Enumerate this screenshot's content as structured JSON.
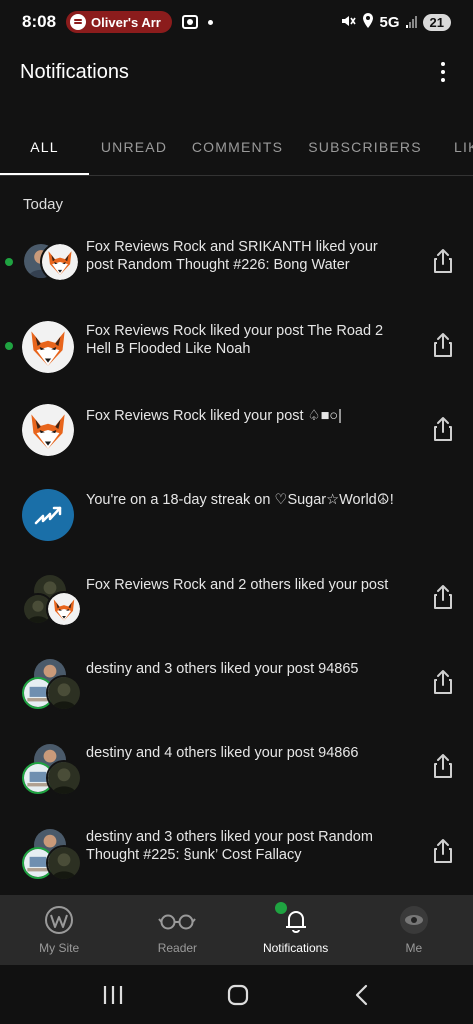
{
  "status_bar": {
    "time": "8:08",
    "media_pill": "Oliver's Arr",
    "network": "5G",
    "battery": "21"
  },
  "header": {
    "title": "Notifications"
  },
  "tabs": [
    {
      "label": "ALL",
      "active": true
    },
    {
      "label": "UNREAD",
      "active": false
    },
    {
      "label": "COMMENTS",
      "active": false
    },
    {
      "label": "SUBSCRIBERS",
      "active": false
    },
    {
      "label": "LIK",
      "active": false
    }
  ],
  "section_today": "Today",
  "notifications": [
    {
      "line1": "Fox Reviews Rock and SRIKANTH liked your",
      "line2": "post Random Thought #226: Bong Water",
      "unread": true,
      "avatar": "fox-and-person"
    },
    {
      "line1": "Fox Reviews Rock liked your post The Road 2",
      "line2": "Hell B Flooded Like Noah",
      "unread": true,
      "avatar": "fox"
    },
    {
      "line1": "Fox Reviews Rock liked your post ♤■○|",
      "line2": "",
      "unread": false,
      "avatar": "fox"
    },
    {
      "line1": "You're on a 18-day streak on ♡Sugar☆World☮!",
      "line2": "",
      "unread": false,
      "avatar": "streak"
    },
    {
      "line1": "Fox Reviews Rock and 2 others liked your post",
      "line2": "",
      "unread": false,
      "avatar": "group-fox"
    },
    {
      "line1": "destiny and 3 others liked your post 94865",
      "line2": "",
      "unread": false,
      "avatar": "group-destiny"
    },
    {
      "line1": "destiny and 4 others liked your post 94866",
      "line2": "",
      "unread": false,
      "avatar": "group-destiny"
    },
    {
      "line1": "destiny and 3 others liked your post Random",
      "line2": "Thought #225: §unk’ Cost Fallacy",
      "unread": false,
      "avatar": "group-destiny"
    }
  ],
  "bottom_nav": [
    {
      "label": "My Site",
      "icon": "wordpress-icon",
      "active": false
    },
    {
      "label": "Reader",
      "icon": "glasses-icon",
      "active": false
    },
    {
      "label": "Notifications",
      "icon": "bell-icon",
      "active": true
    },
    {
      "label": "Me",
      "icon": "profile-avatar",
      "active": false
    }
  ],
  "colors": {
    "background": "#121212",
    "unread": "#1fa341",
    "streak_badge": "#1a6fa8",
    "spotify_pill": "#8b1c1c"
  }
}
